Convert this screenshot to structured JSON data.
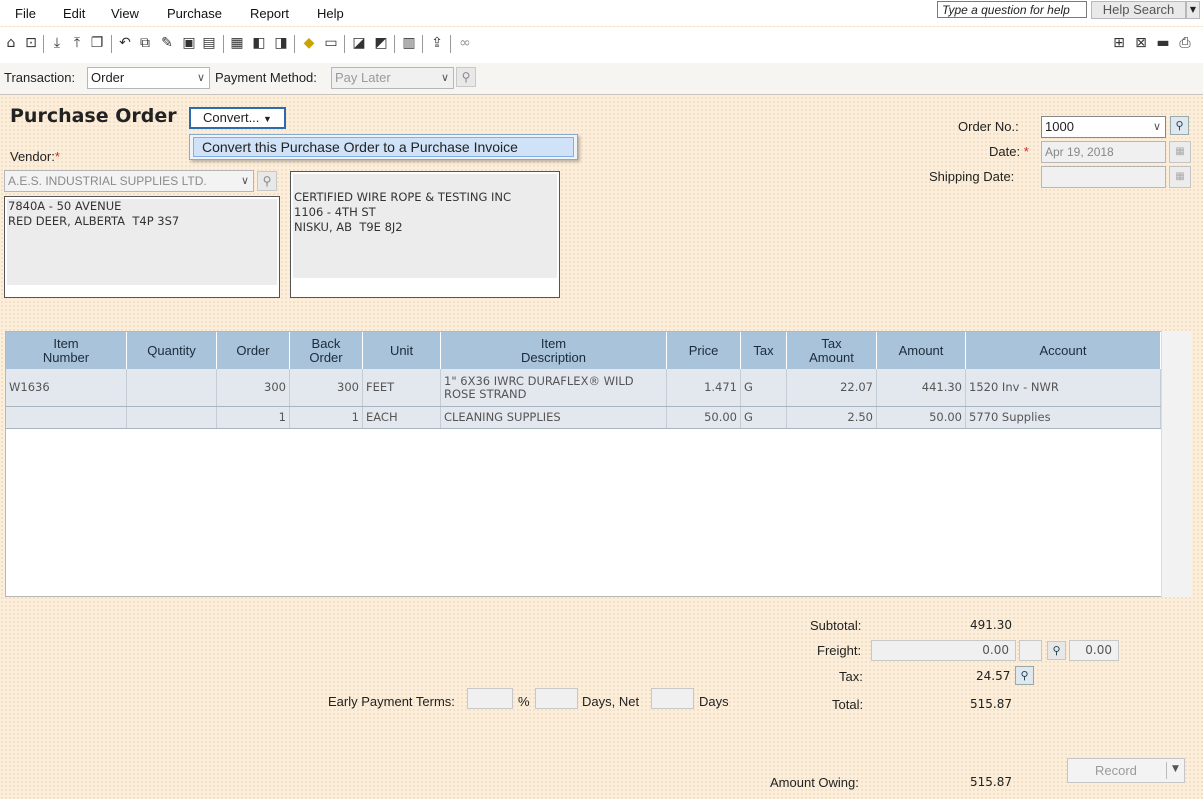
{
  "menu": {
    "file": "File",
    "edit": "Edit",
    "view": "View",
    "purchase": "Purchase",
    "report": "Report",
    "help": "Help"
  },
  "help": {
    "question": "Type a question for help",
    "search": "Help Search"
  },
  "transaction_bar": {
    "transaction_label": "Transaction:",
    "transaction_value": "Order",
    "payment_label": "Payment Method:",
    "payment_value": "Pay Later"
  },
  "header": {
    "title": "Purchase Order",
    "convert_label": "Convert...",
    "convert_menu_item": "Convert this Purchase Order to a Purchase Invoice"
  },
  "vendor": {
    "label": "Vendor:",
    "required_mark": "*",
    "name": "A.E.S. INDUSTRIAL SUPPLIES LTD.",
    "address": "7840A - 50 AVENUE\nRED DEER, ALBERTA  T4P 3S7"
  },
  "ship_to": {
    "address": "CERTIFIED WIRE ROPE & TESTING INC\n1106 - 4TH ST\nNISKU, AB  T9E 8J2"
  },
  "order_info": {
    "order_no_label": "Order No.:",
    "order_no": "1000",
    "date_label": "Date:",
    "required_mark": "*",
    "date": "Apr 19, 2018",
    "shipping_date_label": "Shipping Date:",
    "shipping_date": ""
  },
  "grid": {
    "columns": [
      "Item\nNumber",
      "Quantity",
      "Order",
      "Back\nOrder",
      "Unit",
      "Item\nDescription",
      "Price",
      "Tax",
      "Tax\nAmount",
      "Amount",
      "Account"
    ],
    "rows": [
      {
        "item_number": "W1636",
        "quantity": "",
        "order": "300",
        "back_order": "300",
        "unit": "FEET",
        "description": "1\" 6X36 IWRC DURAFLEX® WILD\nROSE STRAND",
        "price": "1.471",
        "tax": "G",
        "tax_amount": "22.07",
        "amount": "441.30",
        "account": "1520 Inv - NWR"
      },
      {
        "item_number": "",
        "quantity": "",
        "order": "1",
        "back_order": "1",
        "unit": "EACH",
        "description": "CLEANING SUPPLIES",
        "price": "50.00",
        "tax": "G",
        "tax_amount": "2.50",
        "amount": "50.00",
        "account": "5770 Supplies"
      }
    ]
  },
  "totals": {
    "subtotal_label": "Subtotal:",
    "subtotal": "491.30",
    "freight_label": "Freight:",
    "freight": "0.00",
    "freight_tax": "0.00",
    "tax_label": "Tax:",
    "tax": "24.57",
    "total_label": "Total:",
    "total": "515.87",
    "amount_owing_label": "Amount Owing:",
    "amount_owing": "515.87"
  },
  "terms": {
    "label": "Early Payment Terms:",
    "percent_sign": "%",
    "days_net_label": "Days, Net",
    "days_label": "Days",
    "percent": "",
    "days": "",
    "net_days": ""
  },
  "record_label": "Record",
  "colors": {
    "grid_header": "#a9c3da",
    "row_bg": "#e3e8ef",
    "focus_blue": "#2b6cb0",
    "required": "#dd2222"
  }
}
